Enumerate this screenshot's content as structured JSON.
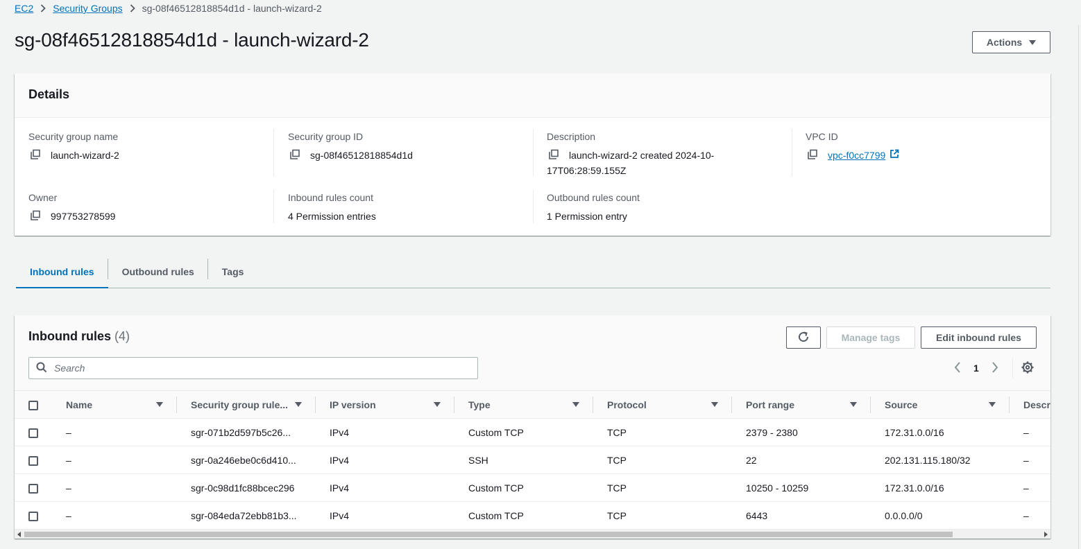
{
  "breadcrumb": {
    "items": [
      "EC2",
      "Security Groups"
    ],
    "current": "sg-08f46512818854d1d - launch-wizard-2"
  },
  "header": {
    "title": "sg-08f46512818854d1d - launch-wizard-2",
    "actions_label": "Actions"
  },
  "details": {
    "title": "Details",
    "sg_name_label": "Security group name",
    "sg_name": "launch-wizard-2",
    "sg_id_label": "Security group ID",
    "sg_id": "sg-08f46512818854d1d",
    "description_label": "Description",
    "description_line1": "launch-wizard-2 created 2024-10-",
    "description_line2": "17T06:28:59.155Z",
    "vpc_label": "VPC ID",
    "vpc_id": "vpc-f0cc7799",
    "owner_label": "Owner",
    "owner": "997753278599",
    "inbound_count_label": "Inbound rules count",
    "inbound_count": "4 Permission entries",
    "outbound_count_label": "Outbound rules count",
    "outbound_count": "1 Permission entry"
  },
  "tabs": [
    {
      "label": "Inbound rules",
      "active": true
    },
    {
      "label": "Outbound rules",
      "active": false
    },
    {
      "label": "Tags",
      "active": false
    }
  ],
  "rules": {
    "title": "Inbound rules",
    "count": "(4)",
    "manage_tags_label": "Manage tags",
    "edit_label": "Edit inbound rules",
    "search_placeholder": "Search",
    "page": "1",
    "columns": [
      "Name",
      "Security group rule...",
      "IP version",
      "Type",
      "Protocol",
      "Port range",
      "Source",
      "Descri"
    ],
    "rows": [
      {
        "name": "–",
        "rule_id": "sgr-071b2d597b5c26...",
        "ip_version": "IPv4",
        "type": "Custom TCP",
        "protocol": "TCP",
        "port_range": "2379 - 2380",
        "source": "172.31.0.0/16",
        "description": "–"
      },
      {
        "name": "–",
        "rule_id": "sgr-0a246ebe0c6d410...",
        "ip_version": "IPv4",
        "type": "SSH",
        "protocol": "TCP",
        "port_range": "22",
        "source": "202.131.115.180/32",
        "description": "–"
      },
      {
        "name": "–",
        "rule_id": "sgr-0c98d1fc88bcec296",
        "ip_version": "IPv4",
        "type": "Custom TCP",
        "protocol": "TCP",
        "port_range": "10250 - 10259",
        "source": "172.31.0.0/16",
        "description": "–"
      },
      {
        "name": "–",
        "rule_id": "sgr-084eda72ebb81b3...",
        "ip_version": "IPv4",
        "type": "Custom TCP",
        "protocol": "TCP",
        "port_range": "6443",
        "source": "0.0.0.0/0",
        "description": "–"
      }
    ]
  },
  "icons": {
    "copy": "copy-icon",
    "external_link": "external-link-icon",
    "refresh": "refresh-icon",
    "settings": "gear-icon",
    "search": "search-icon"
  },
  "colors": {
    "link": "#0073bb",
    "text": "#16191f",
    "secondary": "#545b64",
    "background": "#f2f3f3"
  }
}
